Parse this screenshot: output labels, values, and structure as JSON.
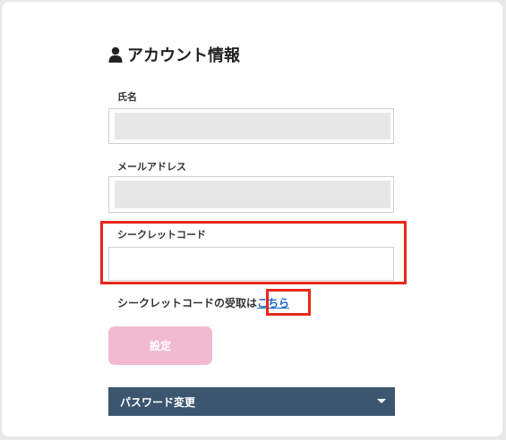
{
  "page": {
    "title": "アカウント情報",
    "title_icon": "user-icon"
  },
  "fields": {
    "name": {
      "label": "氏名",
      "value": ""
    },
    "email": {
      "label": "メールアドレス",
      "value": ""
    },
    "secret_code": {
      "label": "シークレットコード",
      "value": "",
      "placeholder": ""
    }
  },
  "secret_help": {
    "text": "シークレットコードの受取は",
    "link_label": "こちら"
  },
  "submit": {
    "label": "設定"
  },
  "password_section": {
    "label": "パスワード変更",
    "icon": "caret-down-icon"
  },
  "colors": {
    "submit_bg": "#f2bad0",
    "password_bar_bg": "#3d5670",
    "highlight": "#e8261b",
    "link": "#1a66c9"
  }
}
